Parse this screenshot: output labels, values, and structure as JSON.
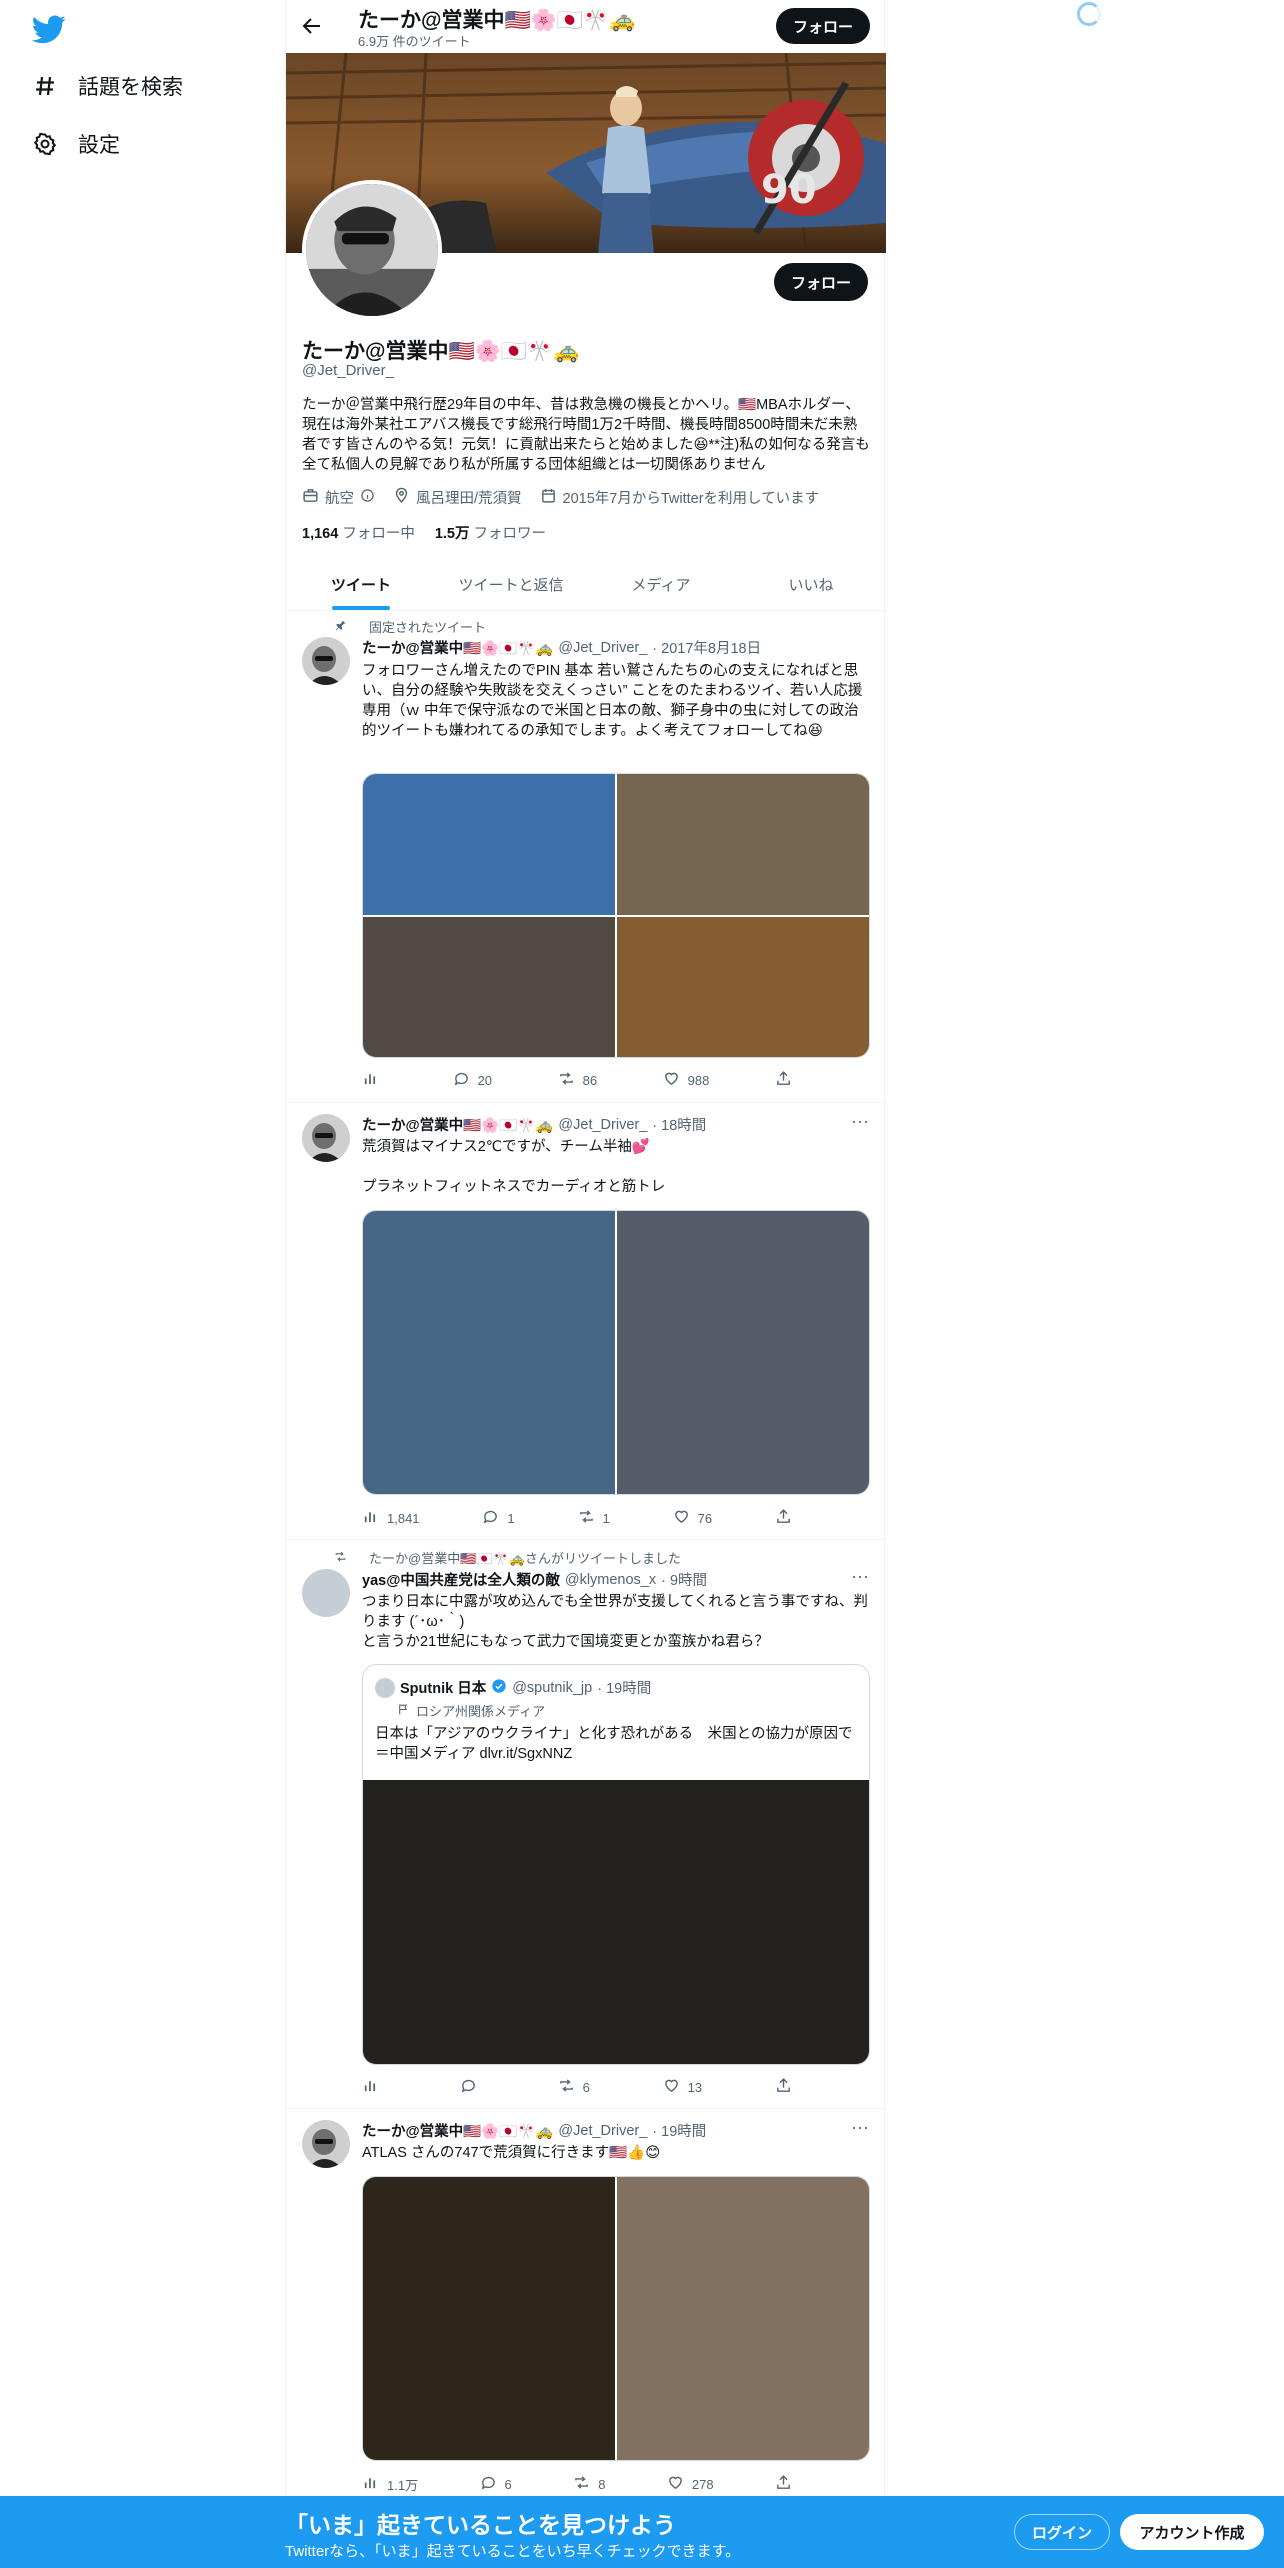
{
  "nav": {
    "items": [
      {
        "label": "話題を検索",
        "icon": "hashtag-icon"
      },
      {
        "label": "設定",
        "icon": "gear-icon"
      }
    ]
  },
  "profile_header": {
    "title": "たーか@営業中🇺🇸🌸🇯🇵🎌🚕",
    "tweet_count": "6.9万 件のツイート",
    "follow_label": "フォロー"
  },
  "profile": {
    "name": "たーか@営業中🇺🇸🌸🇯🇵🎌🚕",
    "handle": "@Jet_Driver_",
    "bio": "たーか＠営業中飛行歴29年目の中年、昔は救急機の機長とかヘリ。🇺🇸MBAホルダー、現在は海外某社エアバス機長です総飛行時間1万2千時間、機長時間8500時間未だ未熟者です皆さんのやる気！元気！に貢献出来たらと始めました😆**注)私の如何なる発言も全て私個人の見解であり私が所属する団体組織とは一切関係ありません",
    "category": "航空",
    "location": "風呂理田/荒須賀",
    "joined": "2015年7月からTwitterを利用しています",
    "following_count": "1,164",
    "following_label": "フォロー中",
    "followers_count": "1.5万",
    "followers_label": "フォロワー",
    "follow_label": "フォロー"
  },
  "tabs": [
    {
      "label": "ツイート",
      "active": true
    },
    {
      "label": "ツイートと返信",
      "active": false
    },
    {
      "label": "メディア",
      "active": false
    },
    {
      "label": "いいね",
      "active": false
    }
  ],
  "tweets": [
    {
      "social": "固定されたツイート",
      "name": "たーか@営業中🇺🇸🌸🇯🇵🎌🚕",
      "handle": "@Jet_Driver_",
      "time": "· 2017年8月18日",
      "text": "フォロワーさん増えたのでPIN 基本 若い鷲さんたちの心の支えになればと思い、自分の経験や失敗談を交えくっさい” ことをのたまわるツイ、若い人応援専用（ｗ 中年で保守派なので米国と日本の敵、獅子身中の虫に対しての政治的ツイートも嫌われてるの承知でします。よく考えてフォローしてね😆",
      "views": "",
      "replies": "20",
      "retweets": "86",
      "likes": "988",
      "media_colors": [
        "#3d6fa8",
        "#77664f",
        "#514a43",
        "#855d31"
      ]
    },
    {
      "social": "",
      "name": "たーか@営業中🇺🇸🌸🇯🇵🎌🚕",
      "handle": "@Jet_Driver_",
      "time": "· 18時間",
      "text": "荒須賀はマイナス2℃ですが、チーム半袖💕\n\nプラネットフィットネスでカーディオと筋トレ",
      "views": "1,841",
      "replies": "1",
      "retweets": "1",
      "likes": "76",
      "media_colors": [
        "#476585",
        "#565c69"
      ]
    },
    {
      "social": "たーか@営業中🇺🇸🇯🇵🎌🚕さんがリツイートしました",
      "name": "yas@中国共産党は全人類の敵",
      "handle": "@klymenos_x",
      "time": "· 9時間",
      "text": "つまり日本に中露が攻め込んでも全世界が支援してくれると言う事ですね、判ります (´･ω･｀)\nと言うか21世紀にもなって武力で国境変更とか蛮族かね君ら？",
      "views": "",
      "replies": "",
      "retweets": "6",
      "likes": "13",
      "quote": {
        "name": "Sputnik 日本",
        "handle": "@sputnik_jp",
        "time": "· 19時間",
        "label": "ロシア州関係メディア",
        "text": "日本は「アジアのウクライナ」と化す恐れがある　米国との協力が原因で＝中国メディア dlvr.it/SgxNNZ",
        "media_color": "#23221f"
      }
    },
    {
      "social": "",
      "name": "たーか@営業中🇺🇸🌸🇯🇵🎌🚕",
      "handle": "@Jet_Driver_",
      "time": "· 19時間",
      "text": "ATLAS さんの747で荒須賀に行きます🇺🇸👍😊",
      "views": "1.1万",
      "replies": "6",
      "retweets": "8",
      "likes": "278",
      "media_colors": [
        "#2d271b",
        "#827060"
      ]
    }
  ],
  "bottom_banner": {
    "title": "「いま」起きていることを見つけよう",
    "subtitle": "Twitterなら、「いま」起きていることをいち早くチェックできます。",
    "login": "ログイン",
    "signup": "アカウント作成"
  },
  "colors": {
    "accent": "#1d9bf0",
    "text": "#0f1419",
    "muted": "#536471"
  }
}
